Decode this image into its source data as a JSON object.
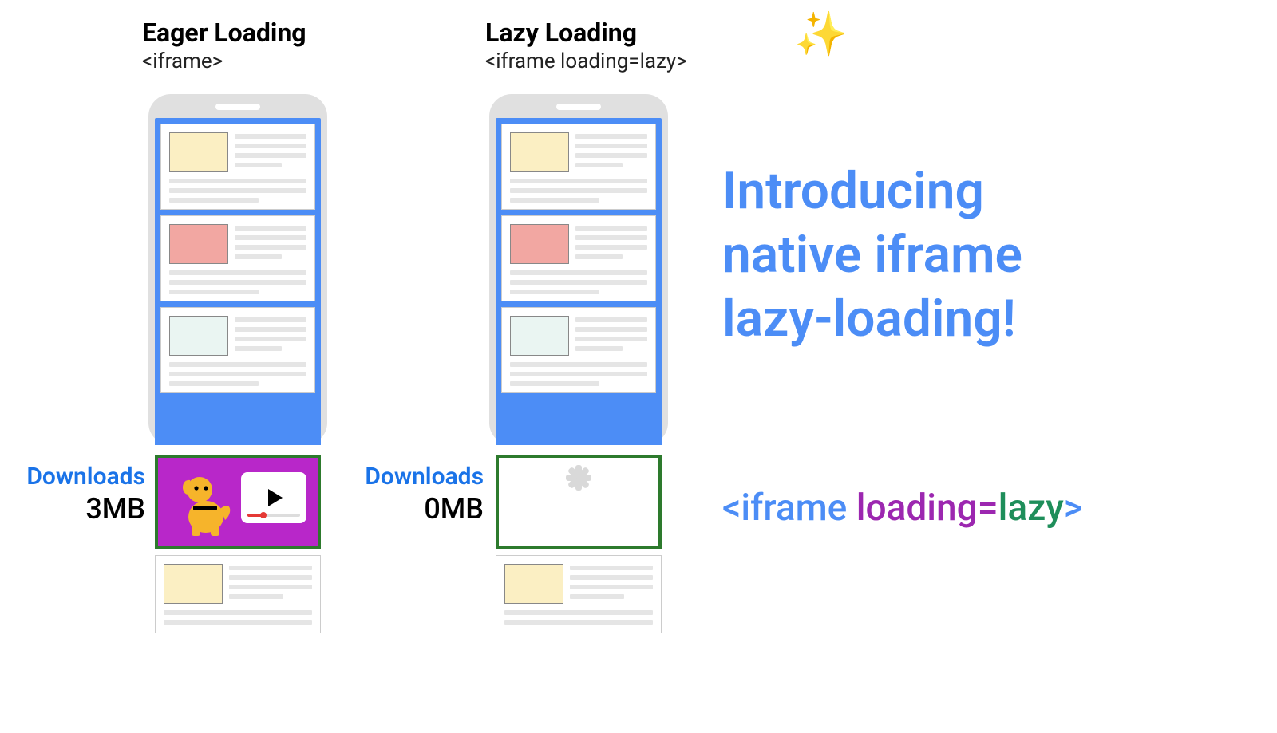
{
  "columns": {
    "eager": {
      "title": "Eager Loading",
      "sub": "<iframe>"
    },
    "lazy": {
      "title": "Lazy Loading",
      "sub": "<iframe loading=lazy>"
    }
  },
  "sparkle": "✨",
  "downloads": {
    "label": "Downloads",
    "eager_size": "3MB",
    "lazy_size": "0MB"
  },
  "hero": {
    "l1": "Introducing",
    "l2": "native iframe",
    "l3": "lazy-loading!"
  },
  "code": {
    "open": "<iframe ",
    "attr": "loading=",
    "val": "lazy",
    "close": ">"
  }
}
